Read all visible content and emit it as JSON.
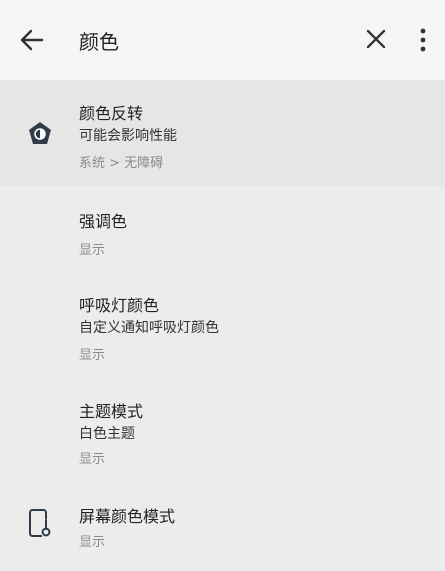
{
  "header": {
    "title": "颜色",
    "back_icon": "arrow-back-icon",
    "close_icon": "close-icon",
    "more_icon": "more-vert-icon"
  },
  "items": [
    {
      "title": "颜色反转",
      "summary": "可能会影响性能",
      "path": "系统 > 无障碍",
      "icon": "color-invert-icon"
    },
    {
      "title": "强调色",
      "summary": "显示"
    },
    {
      "title": "呼吸灯颜色",
      "summary": "自定义通知呼吸灯颜色",
      "path": "显示"
    },
    {
      "title": "主题模式",
      "summary": "白色主题",
      "path": "显示"
    },
    {
      "title": "屏幕颜色模式",
      "summary": "显示",
      "icon": "phone-thermometer-icon"
    }
  ],
  "colors": {
    "background": "#ececec",
    "header_bg": "#f5f5f5",
    "highlight_bg": "#e6e6e6",
    "primary_text": "#222222",
    "secondary_text": "#8a8a8a",
    "icon_dark": "#2f3d4a"
  }
}
